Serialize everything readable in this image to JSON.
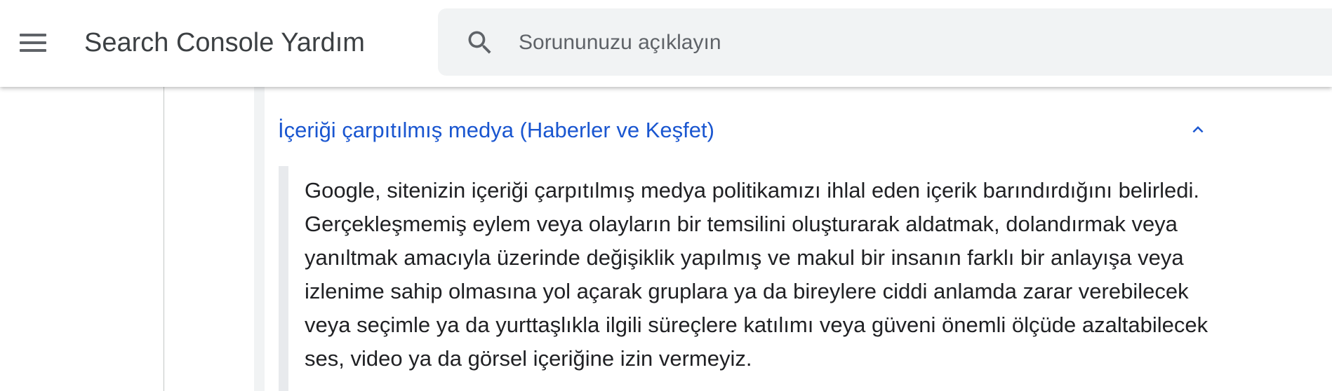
{
  "header": {
    "app_title": "Search Console Yardım",
    "menu_icon": "menu-icon",
    "search": {
      "icon": "search-icon",
      "placeholder": "Sorununuzu açıklayın",
      "value": ""
    }
  },
  "article": {
    "accordion": {
      "title": "İçeriği çarpıtılmış medya (Haberler ve Keşfet)",
      "expanded": true,
      "toggle_icon": "chevron-up-icon",
      "body": "Google, sitenizin içeriği çarpıtılmış medya politikamızı ihlal eden içerik barındırdığını belirledi. Gerçekleşmemiş eylem veya olayların bir temsilini oluşturarak aldatmak, dolandırmak veya yanıltmak amacıyla üzerinde değişiklik yapılmış ve makul bir insanın farklı bir anlayışa veya izlenime sahip olmasına yol açarak gruplara ya da bireylere ciddi anlamda zarar verebilecek veya seçimle ya da yurttaşlıkla ilgili süreçlere katılımı veya güveni önemli ölçüde azaltabilecek ses, video ya da görsel içeriğine izin vermeyiz."
    }
  },
  "colors": {
    "link_blue": "#1a56d0",
    "icon_gray": "#5f6368",
    "search_bg": "#f1f3f4",
    "text": "#202124"
  }
}
